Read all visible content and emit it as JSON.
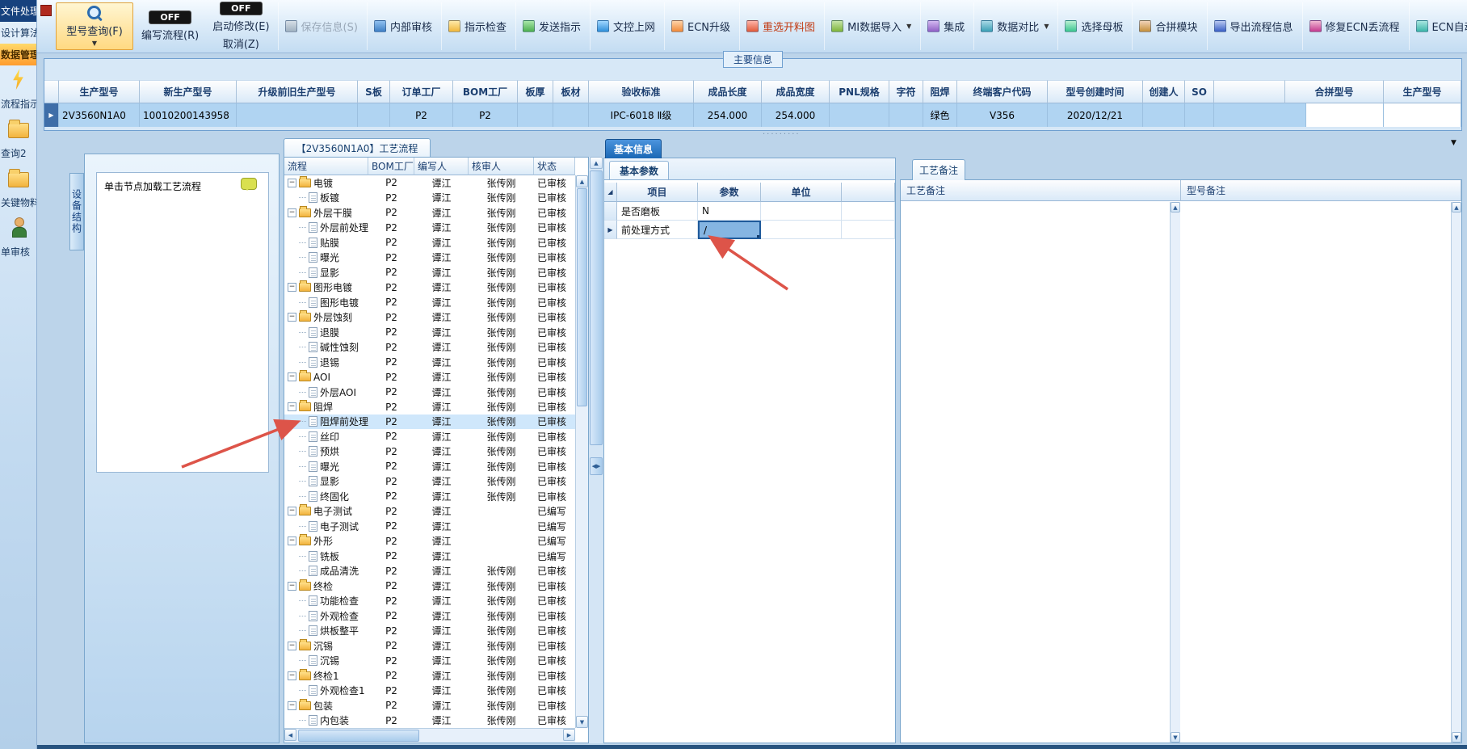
{
  "sidebar": {
    "items": [
      {
        "id": "file-processing",
        "label": "文件处理",
        "style": "dark"
      },
      {
        "id": "design-algorithm",
        "label": "设计算法",
        "style": "plain"
      },
      {
        "id": "data-management",
        "label": "数据管理",
        "style": "active"
      },
      {
        "id": "flow-instruction",
        "label": "流程指示",
        "icon": "lightning",
        "style": "plain"
      },
      {
        "id": "query2",
        "label": "查询2",
        "icon": "folder",
        "style": "plain"
      },
      {
        "id": "key-materials",
        "label": "关键物料",
        "icon": "folder",
        "style": "plain"
      },
      {
        "id": "order-audit",
        "label": "单审核",
        "icon": "person",
        "style": "plain"
      }
    ]
  },
  "toolbar": {
    "model_query": {
      "label": "型号查询(F)",
      "dropdown": "▼"
    },
    "toggles": [
      {
        "state": "OFF",
        "label": "编写流程(R)"
      },
      {
        "state": "OFF",
        "label": "启动修改(E)",
        "sub_label": "取消(Z)"
      }
    ],
    "buttons": [
      {
        "id": "save",
        "label": "保存信息(S)",
        "icon": "save-icon",
        "disabled": true
      },
      {
        "id": "internal-audit",
        "label": "内部审核",
        "icon": "audit-icon"
      },
      {
        "id": "instruction-check",
        "label": "指示检查",
        "icon": "inspect-icon"
      },
      {
        "id": "send-instruction",
        "label": "发送指示",
        "icon": "send-icon"
      },
      {
        "id": "doc-control-upload",
        "label": "文控上网",
        "icon": "docnet-icon"
      },
      {
        "id": "ecn-upgrade",
        "label": "ECN升级",
        "icon": "ecnup-icon"
      },
      {
        "id": "reselect-cutting",
        "label": "重选开料图",
        "icon": "reselect-icon",
        "emphasis": "red"
      },
      {
        "id": "mi-data-import",
        "label": "MI数据导入",
        "icon": "import-icon",
        "dropdown": true
      },
      {
        "id": "integrate",
        "label": "集成",
        "icon": "integrate-icon"
      },
      {
        "id": "data-compare",
        "label": "数据对比",
        "icon": "compare-icon",
        "dropdown": true
      },
      {
        "id": "select-motherboard",
        "label": "选择母板",
        "icon": "board-icon"
      },
      {
        "id": "merge-module",
        "label": "合拼模块",
        "icon": "merge-icon"
      },
      {
        "id": "export-flow-info",
        "label": "导出流程信息",
        "icon": "export-icon"
      },
      {
        "id": "repair-ecn-flow",
        "label": "修复ECN丢流程",
        "icon": "repair-icon"
      },
      {
        "id": "ecn-auto-upload",
        "label": "ECN自动上网",
        "icon": "autonet-icon"
      }
    ]
  },
  "main_info": {
    "title": "主要信息",
    "columns": [
      "生产型号",
      "新生产型号",
      "升级前旧生产型号",
      "S板",
      "订单工厂",
      "BOM工厂",
      "板厚",
      "板材",
      "验收标准",
      "成品长度",
      "成品宽度",
      "PNL规格",
      "字符",
      "阻焊",
      "终端客户代码",
      "型号创建时间",
      "创建人",
      "SO"
    ],
    "row": [
      "2V3560N1A0",
      "10010200143958",
      "",
      "",
      "P2",
      "P2",
      "",
      "",
      "IPC-6018 Ⅱ级",
      "254.000",
      "254.000",
      "",
      "",
      "绿色",
      "V356",
      "2020/12/21",
      "",
      ""
    ],
    "right_columns": [
      "合拼型号",
      "生产型号"
    ]
  },
  "device_panel": {
    "tab": "设备结构",
    "hint": "单击节点加载工艺流程"
  },
  "process_tree": {
    "title": "【2V3560N1A0】工艺流程",
    "columns": [
      "流程",
      "BOM工厂",
      "编写人",
      "核审人",
      "状态"
    ],
    "rows": [
      {
        "label": "电镀",
        "type": "folder",
        "factory": "P2",
        "writer": "谭江",
        "reviewer": "张传刚",
        "status": "已审核"
      },
      {
        "label": "板镀",
        "type": "leaf",
        "factory": "P2",
        "writer": "谭江",
        "reviewer": "张传刚",
        "status": "已审核"
      },
      {
        "label": "外层干膜",
        "type": "folder",
        "factory": "P2",
        "writer": "谭江",
        "reviewer": "张传刚",
        "status": "已审核"
      },
      {
        "label": "外层前处理",
        "type": "leaf",
        "factory": "P2",
        "writer": "谭江",
        "reviewer": "张传刚",
        "status": "已审核"
      },
      {
        "label": "贴膜",
        "type": "leaf",
        "factory": "P2",
        "writer": "谭江",
        "reviewer": "张传刚",
        "status": "已审核"
      },
      {
        "label": "曝光",
        "type": "leaf",
        "factory": "P2",
        "writer": "谭江",
        "reviewer": "张传刚",
        "status": "已审核"
      },
      {
        "label": "显影",
        "type": "leaf",
        "factory": "P2",
        "writer": "谭江",
        "reviewer": "张传刚",
        "status": "已审核"
      },
      {
        "label": "图形电镀",
        "type": "folder",
        "factory": "P2",
        "writer": "谭江",
        "reviewer": "张传刚",
        "status": "已审核"
      },
      {
        "label": "图形电镀",
        "type": "leaf",
        "factory": "P2",
        "writer": "谭江",
        "reviewer": "张传刚",
        "status": "已审核"
      },
      {
        "label": "外层蚀刻",
        "type": "folder",
        "factory": "P2",
        "writer": "谭江",
        "reviewer": "张传刚",
        "status": "已审核"
      },
      {
        "label": "退膜",
        "type": "leaf",
        "factory": "P2",
        "writer": "谭江",
        "reviewer": "张传刚",
        "status": "已审核"
      },
      {
        "label": "碱性蚀刻",
        "type": "leaf",
        "factory": "P2",
        "writer": "谭江",
        "reviewer": "张传刚",
        "status": "已审核"
      },
      {
        "label": "退锡",
        "type": "leaf",
        "factory": "P2",
        "writer": "谭江",
        "reviewer": "张传刚",
        "status": "已审核"
      },
      {
        "label": "AOI",
        "type": "folder",
        "factory": "P2",
        "writer": "谭江",
        "reviewer": "张传刚",
        "status": "已审核"
      },
      {
        "label": "外层AOI",
        "type": "leaf",
        "factory": "P2",
        "writer": "谭江",
        "reviewer": "张传刚",
        "status": "已审核"
      },
      {
        "label": "阻焊",
        "type": "folder",
        "factory": "P2",
        "writer": "谭江",
        "reviewer": "张传刚",
        "status": "已审核"
      },
      {
        "label": "阻焊前处理",
        "type": "leaf",
        "factory": "P2",
        "writer": "谭江",
        "reviewer": "张传刚",
        "status": "已审核",
        "selected": true
      },
      {
        "label": "丝印",
        "type": "leaf",
        "factory": "P2",
        "writer": "谭江",
        "reviewer": "张传刚",
        "status": "已审核"
      },
      {
        "label": "预烘",
        "type": "leaf",
        "factory": "P2",
        "writer": "谭江",
        "reviewer": "张传刚",
        "status": "已审核"
      },
      {
        "label": "曝光",
        "type": "leaf",
        "factory": "P2",
        "writer": "谭江",
        "reviewer": "张传刚",
        "status": "已审核"
      },
      {
        "label": "显影",
        "type": "leaf",
        "factory": "P2",
        "writer": "谭江",
        "reviewer": "张传刚",
        "status": "已审核"
      },
      {
        "label": "终固化",
        "type": "leaf",
        "factory": "P2",
        "writer": "谭江",
        "reviewer": "张传刚",
        "status": "已审核"
      },
      {
        "label": "电子测试",
        "type": "folder",
        "factory": "P2",
        "writer": "谭江",
        "reviewer": "",
        "status": "已编写"
      },
      {
        "label": "电子测试",
        "type": "leaf",
        "factory": "P2",
        "writer": "谭江",
        "reviewer": "",
        "status": "已编写"
      },
      {
        "label": "外形",
        "type": "folder",
        "factory": "P2",
        "writer": "谭江",
        "reviewer": "",
        "status": "已编写"
      },
      {
        "label": "铣板",
        "type": "leaf",
        "factory": "P2",
        "writer": "谭江",
        "reviewer": "",
        "status": "已编写"
      },
      {
        "label": "成品清洗",
        "type": "leaf",
        "factory": "P2",
        "writer": "谭江",
        "reviewer": "张传刚",
        "status": "已审核"
      },
      {
        "label": "终检",
        "type": "folder",
        "factory": "P2",
        "writer": "谭江",
        "reviewer": "张传刚",
        "status": "已审核"
      },
      {
        "label": "功能检查",
        "type": "leaf",
        "factory": "P2",
        "writer": "谭江",
        "reviewer": "张传刚",
        "status": "已审核"
      },
      {
        "label": "外观检查",
        "type": "leaf",
        "factory": "P2",
        "writer": "谭江",
        "reviewer": "张传刚",
        "status": "已审核"
      },
      {
        "label": "烘板整平",
        "type": "leaf",
        "factory": "P2",
        "writer": "谭江",
        "reviewer": "张传刚",
        "status": "已审核"
      },
      {
        "label": "沉锡",
        "type": "folder",
        "factory": "P2",
        "writer": "谭江",
        "reviewer": "张传刚",
        "status": "已审核"
      },
      {
        "label": "沉锡",
        "type": "leaf",
        "factory": "P2",
        "writer": "谭江",
        "reviewer": "张传刚",
        "status": "已审核"
      },
      {
        "label": "终检1",
        "type": "folder",
        "factory": "P2",
        "writer": "谭江",
        "reviewer": "张传刚",
        "status": "已审核"
      },
      {
        "label": "外观检查1",
        "type": "leaf",
        "factory": "P2",
        "writer": "谭江",
        "reviewer": "张传刚",
        "status": "已审核"
      },
      {
        "label": "包装",
        "type": "folder",
        "factory": "P2",
        "writer": "谭江",
        "reviewer": "张传刚",
        "status": "已审核"
      },
      {
        "label": "内包装",
        "type": "leaf",
        "factory": "P2",
        "writer": "谭江",
        "reviewer": "张传刚",
        "status": "已审核"
      }
    ]
  },
  "basic_info": {
    "tab": "基本信息",
    "sub_tab": "基本参数",
    "columns": [
      "项目",
      "参数",
      "单位"
    ],
    "rows": [
      {
        "item": "是否磨板",
        "value": "N",
        "unit": "",
        "selected": false
      },
      {
        "item": "前处理方式",
        "value": "/",
        "unit": "",
        "selected": true
      }
    ]
  },
  "remarks": {
    "tab": "工艺备注",
    "columns": [
      "工艺备注",
      "型号备注"
    ]
  },
  "annotations": {
    "arrow_color": "#dd5449"
  }
}
